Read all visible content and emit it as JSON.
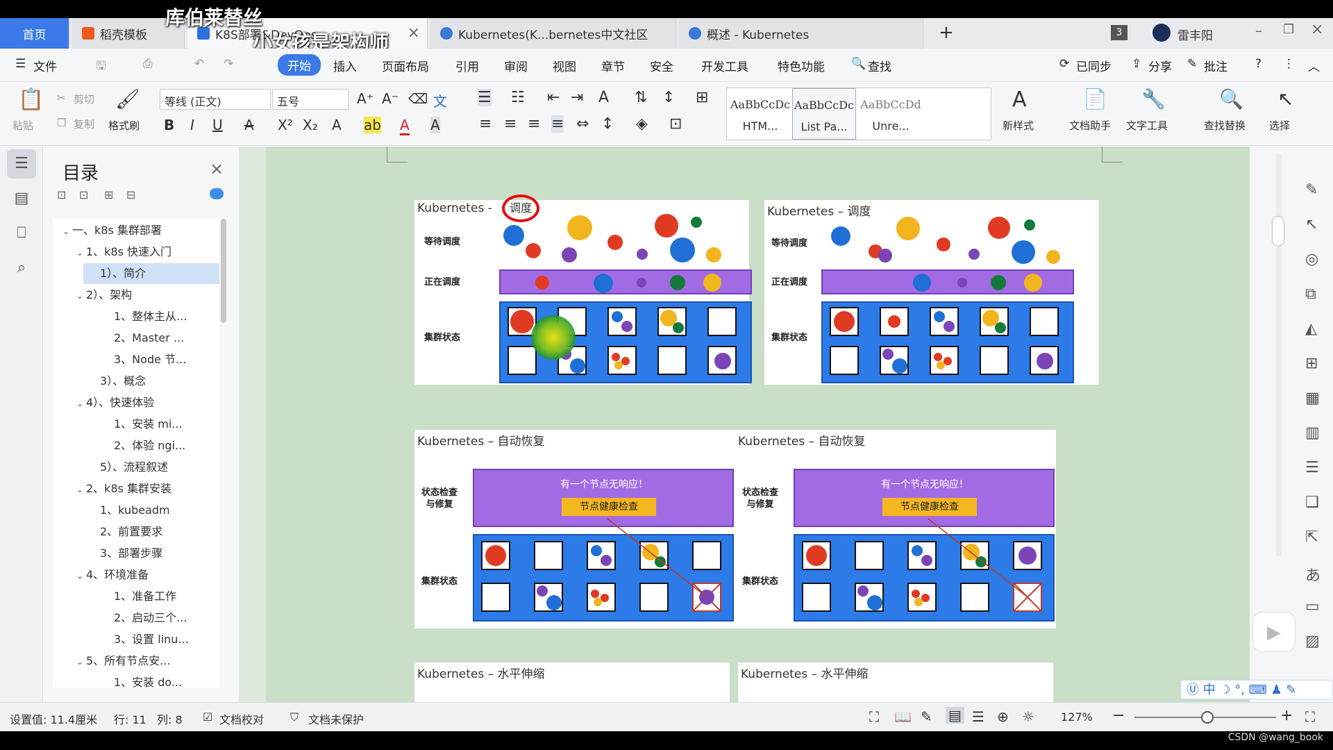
{
  "overlay": {
    "line1": "库伯莱替丝",
    "line2": "小女孩是架构师"
  },
  "tabs": [
    {
      "label": "首页"
    },
    {
      "label": "稻壳模板"
    },
    {
      "label": "K8S部署&DevOps..."
    },
    {
      "label": "Kubernetes(K...bernetes中文社区"
    },
    {
      "label": "概述 - Kubernetes"
    }
  ],
  "tab_add": "+",
  "badge": "3",
  "user": "雷丰阳",
  "menu": {
    "file": "文件",
    "items": [
      "开始",
      "插入",
      "页面布局",
      "引用",
      "审阅",
      "视图",
      "章节",
      "安全",
      "开发工具",
      "特色功能"
    ],
    "search": "查找",
    "sync": "已同步",
    "share": "分享",
    "comment": "批注"
  },
  "ribbon": {
    "paste": "粘贴",
    "cut": "剪切",
    "copy": "复制",
    "format_painter": "格式刷",
    "font": "等线 (正文)",
    "size": "五号",
    "styles": [
      {
        "sample": "AaBbCcDc",
        "name": "HTM..."
      },
      {
        "sample": "AaBbCcDc",
        "name": "List Pa..."
      },
      {
        "sample": "AaBbCcDd",
        "name": "Unre..."
      }
    ],
    "new_style": "新样式",
    "doc_helper": "文档助手",
    "text_tools": "文字工具",
    "find_replace": "查找替换",
    "select": "选择"
  },
  "nav": {
    "title": "目录",
    "items": [
      {
        "label": "一、k8s 集群部署",
        "level": 0,
        "chev": "v"
      },
      {
        "label": "1、k8s 快速入门",
        "level": 1,
        "chev": "v"
      },
      {
        "label": "1）、简介",
        "level": 2,
        "chev": "",
        "selected": true
      },
      {
        "label": "2）、架构",
        "level": 1,
        "chev": "v"
      },
      {
        "label": "1、整体主从...",
        "level": 3,
        "chev": ""
      },
      {
        "label": "2、Master ...",
        "level": 3,
        "chev": ""
      },
      {
        "label": "3、Node 节...",
        "level": 3,
        "chev": ""
      },
      {
        "label": "3）、概念",
        "level": 2,
        "chev": ""
      },
      {
        "label": "4）、快速体验",
        "level": 1,
        "chev": "v"
      },
      {
        "label": "1、安装 mi...",
        "level": 3,
        "chev": ""
      },
      {
        "label": "2、体验 ngi...",
        "level": 3,
        "chev": ""
      },
      {
        "label": "5）、流程叙述",
        "level": 2,
        "chev": ""
      },
      {
        "label": "2、k8s 集群安装",
        "level": 0,
        "chev": "v",
        "indent": 1
      },
      {
        "label": "1、kubeadm",
        "level": 2,
        "chev": ""
      },
      {
        "label": "2、前置要求",
        "level": 2,
        "chev": ""
      },
      {
        "label": "3、部署步骤",
        "level": 2,
        "chev": ""
      },
      {
        "label": "4、环境准备",
        "level": 1,
        "chev": "v"
      },
      {
        "label": "1、准备工作",
        "level": 3,
        "chev": ""
      },
      {
        "label": "2、启动三个...",
        "level": 3,
        "chev": ""
      },
      {
        "label": "3、设置 linu...",
        "level": 3,
        "chev": ""
      },
      {
        "label": "5、所有节点安...",
        "level": 1,
        "chev": "v"
      },
      {
        "label": "1、安装 do...",
        "level": 3,
        "chev": ""
      }
    ]
  },
  "slides": {
    "sched_title_a": "Kubernetes -",
    "sched_tag": "调度",
    "sched_title_b": "Kubernetes – 调度",
    "wait": "等待调度",
    "running": "正在调度",
    "cluster": "集群状态",
    "heal_title": "Kubernetes – 自动恢复",
    "health_check": "状态检查\n与修复",
    "no_response": "有一个节点无响应！",
    "health_btn": "节点健康检查",
    "scale_title": "Kubernetes – 水平伸缩"
  },
  "status": {
    "setting": "设置值: 11.4厘米",
    "row": "行: 11",
    "col": "列: 8",
    "proof": "文档校对",
    "protect": "文档未保护",
    "zoom": "127%"
  },
  "watermark": "CSDN @wang_book",
  "colors": {
    "accent": "#3b7ae8",
    "red": "#e03b22",
    "yellow": "#f2b51d",
    "purple": "#7b45b7",
    "blue": "#1f6fd6",
    "green": "#127a3a"
  }
}
